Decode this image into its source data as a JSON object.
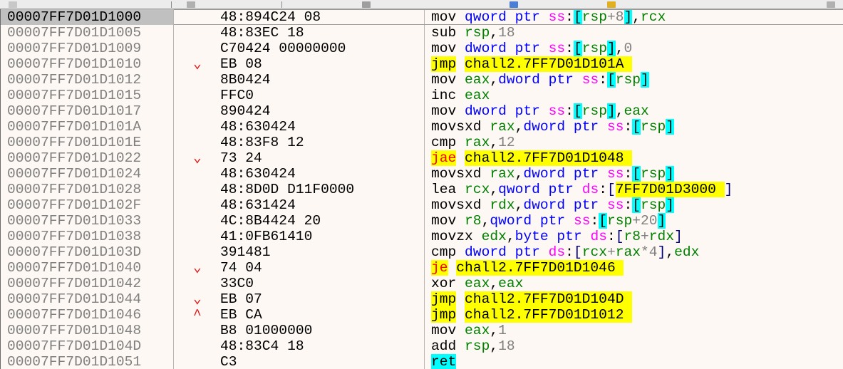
{
  "toolbar": {
    "icons": [
      "tool-icon-1",
      "tool-icon-2",
      "tool-icon-3",
      "tool-icon-4",
      "tool-icon-5",
      "tool-icon-6"
    ]
  },
  "colors": {
    "background": "#fdf8f3",
    "selected_address_bg": "#c0c0c0",
    "address_text": "#808080",
    "jump_highlight": "#ffff00",
    "bracket_highlight": "#00ffff",
    "register": "#008000",
    "segment": "#ff00ff",
    "size_keyword": "#0000ff",
    "arrow": "#e01414"
  },
  "rows": [
    {
      "address": "00007FF7D01D1000",
      "arrow": "",
      "bytes": "48:894C24 08",
      "selected": true,
      "asm": [
        [
          "mn",
          "mov "
        ],
        [
          "kw",
          "qword ptr "
        ],
        [
          "seg",
          "ss"
        ],
        [
          "pun",
          ":"
        ],
        [
          "brk",
          "["
        ],
        [
          "reg",
          "rsp"
        ],
        [
          "num",
          "+8"
        ],
        [
          "brk",
          "]"
        ],
        [
          "pun",
          ","
        ],
        [
          "reg",
          "rcx"
        ]
      ]
    },
    {
      "address": "00007FF7D01D1005",
      "arrow": "",
      "bytes": "48:83EC 18",
      "asm": [
        [
          "mn",
          "sub "
        ],
        [
          "reg",
          "rsp"
        ],
        [
          "pun",
          ","
        ],
        [
          "hex",
          "18"
        ]
      ]
    },
    {
      "address": "00007FF7D01D1009",
      "arrow": "",
      "bytes": "C70424 00000000",
      "asm": [
        [
          "mn",
          "mov "
        ],
        [
          "kw",
          "dword ptr "
        ],
        [
          "seg",
          "ss"
        ],
        [
          "pun",
          ":"
        ],
        [
          "brk",
          "["
        ],
        [
          "reg",
          "rsp"
        ],
        [
          "brk",
          "]"
        ],
        [
          "pun",
          ","
        ],
        [
          "hex",
          "0"
        ]
      ]
    },
    {
      "address": "00007FF7D01D1010",
      "arrow": "⌄",
      "bytes": "EB 08",
      "asm": [
        [
          "jmpy",
          "jmp"
        ],
        [
          "pun",
          " "
        ],
        [
          "addrlbl",
          "chall2.7FF7D01D101A "
        ]
      ]
    },
    {
      "address": "00007FF7D01D1012",
      "arrow": "",
      "bytes": "8B0424",
      "asm": [
        [
          "mn",
          "mov "
        ],
        [
          "reg",
          "eax"
        ],
        [
          "pun",
          ","
        ],
        [
          "kw",
          "dword ptr "
        ],
        [
          "seg",
          "ss"
        ],
        [
          "pun",
          ":"
        ],
        [
          "brk",
          "["
        ],
        [
          "reg",
          "rsp"
        ],
        [
          "brk",
          "]"
        ]
      ]
    },
    {
      "address": "00007FF7D01D1015",
      "arrow": "",
      "bytes": "FFC0",
      "asm": [
        [
          "mn",
          "inc "
        ],
        [
          "reg",
          "eax"
        ]
      ]
    },
    {
      "address": "00007FF7D01D1017",
      "arrow": "",
      "bytes": "890424",
      "asm": [
        [
          "mn",
          "mov "
        ],
        [
          "kw",
          "dword ptr "
        ],
        [
          "seg",
          "ss"
        ],
        [
          "pun",
          ":"
        ],
        [
          "brk",
          "["
        ],
        [
          "reg",
          "rsp"
        ],
        [
          "brk",
          "]"
        ],
        [
          "pun",
          ","
        ],
        [
          "reg",
          "eax"
        ]
      ]
    },
    {
      "address": "00007FF7D01D101A",
      "arrow": "",
      "bytes": "48:630424",
      "asm": [
        [
          "mn",
          "movsxd "
        ],
        [
          "reg",
          "rax"
        ],
        [
          "pun",
          ","
        ],
        [
          "kw",
          "dword ptr "
        ],
        [
          "seg",
          "ss"
        ],
        [
          "pun",
          ":"
        ],
        [
          "brk",
          "["
        ],
        [
          "reg",
          "rsp"
        ],
        [
          "brk",
          "]"
        ]
      ]
    },
    {
      "address": "00007FF7D01D101E",
      "arrow": "",
      "bytes": "48:83F8 12",
      "asm": [
        [
          "mn",
          "cmp "
        ],
        [
          "reg",
          "rax"
        ],
        [
          "pun",
          ","
        ],
        [
          "hex",
          "12"
        ]
      ]
    },
    {
      "address": "00007FF7D01D1022",
      "arrow": "⌄",
      "bytes": "73 24",
      "asm": [
        [
          "jcc",
          "jae"
        ],
        [
          "pun",
          " "
        ],
        [
          "addrlbl",
          "chall2.7FF7D01D1048 "
        ]
      ]
    },
    {
      "address": "00007FF7D01D1024",
      "arrow": "",
      "bytes": "48:630424",
      "asm": [
        [
          "mn",
          "movsxd "
        ],
        [
          "reg",
          "rax"
        ],
        [
          "pun",
          ","
        ],
        [
          "kw",
          "dword ptr "
        ],
        [
          "seg",
          "ss"
        ],
        [
          "pun",
          ":"
        ],
        [
          "brk",
          "["
        ],
        [
          "reg",
          "rsp"
        ],
        [
          "brk",
          "]"
        ]
      ]
    },
    {
      "address": "00007FF7D01D1028",
      "arrow": "",
      "bytes": "48:8D0D D11F0000",
      "asm": [
        [
          "mn",
          "lea "
        ],
        [
          "reg",
          "rcx"
        ],
        [
          "pun",
          ","
        ],
        [
          "kw",
          "qword ptr "
        ],
        [
          "seg",
          "ds"
        ],
        [
          "pun",
          ":"
        ],
        [
          "dbr",
          "["
        ],
        [
          "addrlbl",
          "7FF7D01D3000 "
        ],
        [
          "dbr",
          "]"
        ]
      ]
    },
    {
      "address": "00007FF7D01D102F",
      "arrow": "",
      "bytes": "48:631424",
      "asm": [
        [
          "mn",
          "movsxd "
        ],
        [
          "reg",
          "rdx"
        ],
        [
          "pun",
          ","
        ],
        [
          "kw",
          "dword ptr "
        ],
        [
          "seg",
          "ss"
        ],
        [
          "pun",
          ":"
        ],
        [
          "brk",
          "["
        ],
        [
          "reg",
          "rsp"
        ],
        [
          "brk",
          "]"
        ]
      ]
    },
    {
      "address": "00007FF7D01D1033",
      "arrow": "",
      "bytes": "4C:8B4424 20",
      "asm": [
        [
          "mn",
          "mov "
        ],
        [
          "reg",
          "r8"
        ],
        [
          "pun",
          ","
        ],
        [
          "kw",
          "qword ptr "
        ],
        [
          "seg",
          "ss"
        ],
        [
          "pun",
          ":"
        ],
        [
          "brk",
          "["
        ],
        [
          "reg",
          "rsp"
        ],
        [
          "num",
          "+20"
        ],
        [
          "brk",
          "]"
        ]
      ]
    },
    {
      "address": "00007FF7D01D1038",
      "arrow": "",
      "bytes": "41:0FB61410",
      "asm": [
        [
          "mn",
          "movzx "
        ],
        [
          "reg",
          "edx"
        ],
        [
          "pun",
          ","
        ],
        [
          "kw",
          "byte ptr "
        ],
        [
          "seg",
          "ds"
        ],
        [
          "pun",
          ":"
        ],
        [
          "dbr",
          "["
        ],
        [
          "reg",
          "r8"
        ],
        [
          "num",
          "+"
        ],
        [
          "reg",
          "rdx"
        ],
        [
          "dbr",
          "]"
        ]
      ]
    },
    {
      "address": "00007FF7D01D103D",
      "arrow": "",
      "bytes": "391481",
      "asm": [
        [
          "mn",
          "cmp "
        ],
        [
          "kw",
          "dword ptr "
        ],
        [
          "seg",
          "ds"
        ],
        [
          "pun",
          ":"
        ],
        [
          "dbr",
          "["
        ],
        [
          "reg",
          "rcx"
        ],
        [
          "num",
          "+"
        ],
        [
          "reg",
          "rax"
        ],
        [
          "num",
          "*4"
        ],
        [
          "dbr",
          "]"
        ],
        [
          "pun",
          ","
        ],
        [
          "reg",
          "edx"
        ]
      ]
    },
    {
      "address": "00007FF7D01D1040",
      "arrow": "⌄",
      "bytes": "74 04",
      "asm": [
        [
          "jcc",
          "je"
        ],
        [
          "pun",
          " "
        ],
        [
          "addrlbl",
          "chall2.7FF7D01D1046 "
        ]
      ]
    },
    {
      "address": "00007FF7D01D1042",
      "arrow": "",
      "bytes": "33C0",
      "asm": [
        [
          "mn",
          "xor "
        ],
        [
          "reg",
          "eax"
        ],
        [
          "pun",
          ","
        ],
        [
          "reg",
          "eax"
        ]
      ]
    },
    {
      "address": "00007FF7D01D1044",
      "arrow": "⌄",
      "bytes": "EB 07",
      "asm": [
        [
          "jmpy",
          "jmp"
        ],
        [
          "pun",
          " "
        ],
        [
          "addrlbl",
          "chall2.7FF7D01D104D "
        ]
      ]
    },
    {
      "address": "00007FF7D01D1046",
      "arrow": "^",
      "bytes": "EB CA",
      "asm": [
        [
          "jmpy",
          "jmp"
        ],
        [
          "pun",
          " "
        ],
        [
          "addrlbl",
          "chall2.7FF7D01D1012 "
        ]
      ]
    },
    {
      "address": "00007FF7D01D1048",
      "arrow": "",
      "bytes": "B8 01000000",
      "asm": [
        [
          "mn",
          "mov "
        ],
        [
          "reg",
          "eax"
        ],
        [
          "pun",
          ","
        ],
        [
          "hex",
          "1"
        ]
      ]
    },
    {
      "address": "00007FF7D01D104D",
      "arrow": "",
      "bytes": "48:83C4 18",
      "asm": [
        [
          "mn",
          "add "
        ],
        [
          "reg",
          "rsp"
        ],
        [
          "pun",
          ","
        ],
        [
          "hex",
          "18"
        ]
      ]
    },
    {
      "address": "00007FF7D01D1051",
      "arrow": "",
      "bytes": "C3",
      "asm": [
        [
          "ret",
          "ret"
        ]
      ]
    }
  ]
}
